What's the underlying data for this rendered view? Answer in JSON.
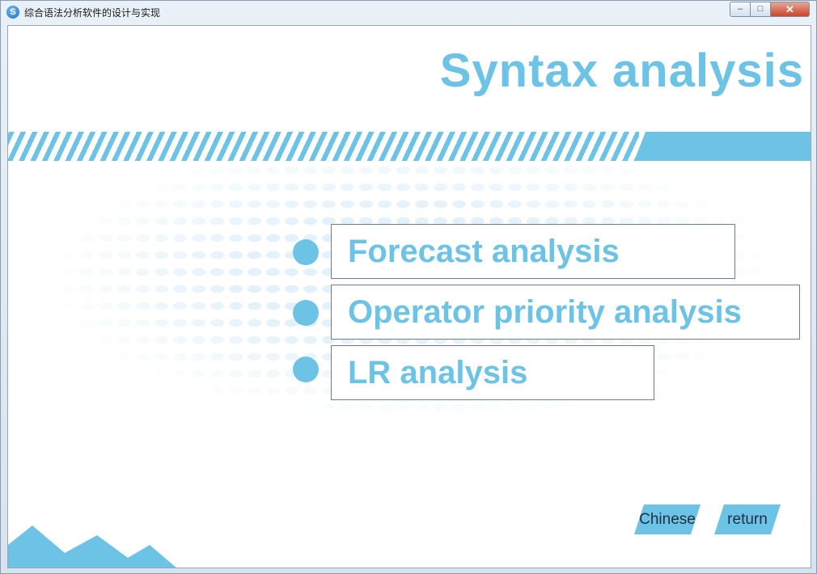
{
  "window": {
    "title": "综合语法分析软件的设计与实现",
    "app_icon_glyph": "S",
    "controls": {
      "minimize": "–",
      "maximize": "□",
      "close": "✕"
    }
  },
  "page": {
    "heading": "Syntax analysis",
    "menu": [
      {
        "label": "Forecast analysis"
      },
      {
        "label": "Operator priority analysis"
      },
      {
        "label": "LR analysis"
      }
    ],
    "buttons": {
      "language": "Chinese",
      "back": "return"
    }
  },
  "colors": {
    "accent": "#6cc3e6",
    "border": "#6b7d91",
    "dot_pattern": "#e2f1fa",
    "close_button": "#c8452c"
  }
}
